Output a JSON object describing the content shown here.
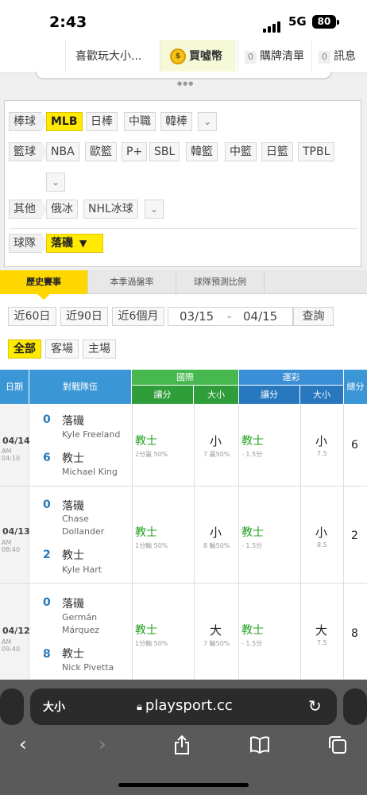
{
  "status_bar": {
    "time": "2:43",
    "network": "5G",
    "battery": "80"
  },
  "top_nav": {
    "favorite": "喜歡玩大小...",
    "coin_label": "買噓幣",
    "cart_count": "0",
    "cart_label": "購牌清單",
    "msg_count": "0",
    "msg_label": "訊息"
  },
  "filters": {
    "baseball": {
      "label": "棒球",
      "options": [
        "MLB",
        "日棒",
        "中職",
        "韓棒"
      ],
      "selected": "MLB"
    },
    "basketball": {
      "label": "籃球",
      "options": [
        "NBA",
        "歐籃",
        "P+",
        "SBL",
        "韓籃",
        "中籃",
        "日籃",
        "TPBL"
      ]
    },
    "other": {
      "label": "其他",
      "options": [
        "俄冰",
        "NHL冰球"
      ]
    },
    "team": {
      "label": "球隊",
      "value": "落磯"
    }
  },
  "tabs": [
    "歷史賽事",
    "本季過盤率",
    "球隊預測比例"
  ],
  "range_buttons": [
    "近60日",
    "近90日",
    "近6個月"
  ],
  "date_range": {
    "start": "03/15",
    "sep": "-",
    "end": "04/15",
    "query": "查詢"
  },
  "location_filters": [
    "全部",
    "客場",
    "主場"
  ],
  "table": {
    "headers": {
      "date": "日期",
      "matchup": "對戰隊伍",
      "intl": "國際",
      "lottery": "運彩",
      "spread": "讓分",
      "ou": "大小",
      "total": "總分"
    },
    "rows": [
      {
        "date": "04/14",
        "time": "AM 04:10",
        "away_score": "0",
        "away": "落磯",
        "away_pitcher": "Kyle Freeland",
        "home_score": "6",
        "home": "教士",
        "home_pitcher": "Michael King",
        "intl_spread": "教士",
        "intl_spread_sub": "2分贏 50%",
        "intl_ou": "小",
        "intl_ou_sub": "7 贏50%",
        "lot_spread": "教士",
        "lot_spread_sub": "- 1.5分",
        "lot_ou": "小",
        "lot_ou_sub": "7.5",
        "total": "6"
      },
      {
        "date": "04/13",
        "time": "AM 08:40",
        "away_score": "0",
        "away": "落磯",
        "away_pitcher": "Chase Dollander",
        "home_score": "2",
        "home": "教士",
        "home_pitcher": "Kyle Hart",
        "intl_spread": "教士",
        "intl_spread_sub": "1分輸 50%",
        "intl_ou": "小",
        "intl_ou_sub": "8 輸50%",
        "lot_spread": "教士",
        "lot_spread_sub": "- 1.5分",
        "lot_ou": "小",
        "lot_ou_sub": "8.5",
        "total": "2"
      },
      {
        "date": "04/12",
        "time": "AM 09:40",
        "away_score": "0",
        "away": "落磯",
        "away_pitcher": "Germán Márquez",
        "home_score": "8",
        "home": "教士",
        "home_pitcher": "Nick Pivetta",
        "intl_spread": "教士",
        "intl_spread_sub": "1分輸 50%",
        "intl_ou": "大",
        "intl_ou_sub": "7 輸50%",
        "lot_spread": "教士",
        "lot_spread_sub": "- 1.5分",
        "lot_ou": "大",
        "lot_ou_sub": "7.5",
        "total": "8"
      }
    ]
  },
  "browser": {
    "text_size": "大小",
    "url": "playsport.cc"
  },
  "colors": {
    "accent_yellow": "#ffe600",
    "header_blue": "#2e8fd0",
    "header_green": "#3fae49",
    "pick_green": "#22a022"
  }
}
